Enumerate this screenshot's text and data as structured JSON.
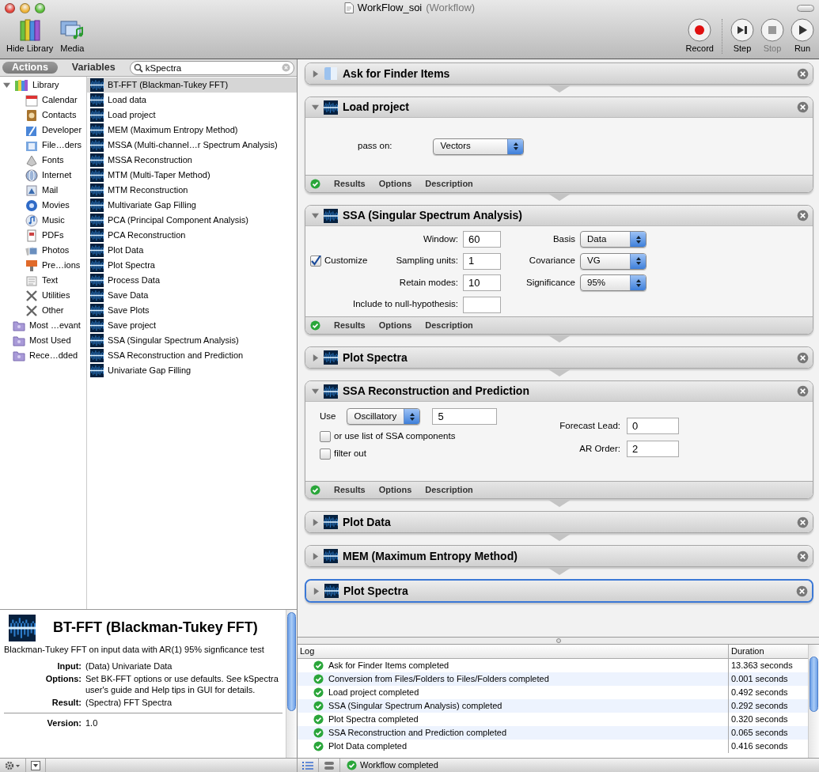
{
  "window": {
    "title": "WorkFlow_soi",
    "subtitle": "(Workflow)"
  },
  "toolbar": {
    "left": [
      {
        "label": "Hide Library",
        "kind": "library"
      },
      {
        "label": "Media",
        "kind": "media"
      }
    ],
    "right": [
      {
        "label": "Record",
        "kind": "record",
        "disabled": false
      },
      {
        "label": "Step",
        "kind": "step",
        "disabled": false
      },
      {
        "label": "Stop",
        "kind": "stop",
        "disabled": true
      },
      {
        "label": "Run",
        "kind": "run",
        "disabled": false
      }
    ]
  },
  "library_tabs": [
    {
      "label": "Actions",
      "selected": true
    },
    {
      "label": "Variables",
      "selected": false
    }
  ],
  "search": {
    "value": "kSpectra"
  },
  "categories": [
    {
      "label": "Library",
      "kind": "library",
      "children": [
        {
          "label": "Calendar",
          "kind": "calendar"
        },
        {
          "label": "Contacts",
          "kind": "contacts"
        },
        {
          "label": "Developer",
          "kind": "developer"
        },
        {
          "label": "File…ders",
          "kind": "files"
        },
        {
          "label": "Fonts",
          "kind": "fonts"
        },
        {
          "label": "Internet",
          "kind": "internet"
        },
        {
          "label": "Mail",
          "kind": "mail"
        },
        {
          "label": "Movies",
          "kind": "movies"
        },
        {
          "label": "Music",
          "kind": "music"
        },
        {
          "label": "PDFs",
          "kind": "pdfs"
        },
        {
          "label": "Photos",
          "kind": "photos"
        },
        {
          "label": "Pre…ions",
          "kind": "presentations"
        },
        {
          "label": "Text",
          "kind": "text"
        },
        {
          "label": "Utilities",
          "kind": "tools"
        },
        {
          "label": "Other",
          "kind": "tools"
        }
      ]
    },
    {
      "label": "Most …evant",
      "kind": "smart_folder"
    },
    {
      "label": "Most Used",
      "kind": "smart_folder"
    },
    {
      "label": "Rece…dded",
      "kind": "smart_folder"
    }
  ],
  "actions": [
    {
      "label": "BT-FFT (Blackman-Tukey FFT)",
      "selected": true
    },
    {
      "label": "Load data",
      "selected": false
    },
    {
      "label": "Load project",
      "selected": false
    },
    {
      "label": "MEM (Maximum Entropy Method)",
      "selected": false
    },
    {
      "label": "MSSA (Multi-channel…r Spectrum Analysis)",
      "selected": false
    },
    {
      "label": "MSSA Reconstruction",
      "selected": false
    },
    {
      "label": "MTM (Multi-Taper Method)",
      "selected": false
    },
    {
      "label": "MTM Reconstruction",
      "selected": false
    },
    {
      "label": "Multivariate Gap Filling",
      "selected": false
    },
    {
      "label": "PCA (Principal Component Analysis)",
      "selected": false
    },
    {
      "label": "PCA Reconstruction",
      "selected": false
    },
    {
      "label": "Plot Data",
      "selected": false
    },
    {
      "label": "Plot Spectra",
      "selected": false
    },
    {
      "label": "Process Data",
      "selected": false
    },
    {
      "label": "Save Data",
      "selected": false
    },
    {
      "label": "Save Plots",
      "selected": false
    },
    {
      "label": "Save project",
      "selected": false
    },
    {
      "label": "SSA (Singular Spectrum Analysis)",
      "selected": false
    },
    {
      "label": "SSA Reconstruction and Prediction",
      "selected": false
    },
    {
      "label": "Univariate Gap Filling",
      "selected": false
    }
  ],
  "description": {
    "title": "BT-FFT (Blackman-Tukey FFT)",
    "summary": "Blackman-Tukey FFT on input data with AR(1) 95% signficance test",
    "fields": [
      {
        "label": "Input:",
        "value": "(Data) Univariate Data"
      },
      {
        "label": "Options:",
        "value": "Set BK-FFT options or use defaults. See kSpectra user's guide and Help tips in GUI for details."
      },
      {
        "label": "Result:",
        "value": "(Spectra) FFT Spectra"
      }
    ],
    "version": {
      "label": "Version:",
      "value": "1.0"
    }
  },
  "workflow": [
    {
      "title": "Ask for Finder Items",
      "kind": "finder",
      "expanded": false,
      "selected": false
    },
    {
      "title": "Load project",
      "kind": "spectrum",
      "expanded": true,
      "selected": false,
      "body": {
        "kind": "pass_on",
        "label": "pass on:",
        "value": "Vectors"
      },
      "footer": [
        "Results",
        "Options",
        "Description"
      ]
    },
    {
      "title": "SSA (Singular Spectrum Analysis)",
      "kind": "spectrum",
      "expanded": true,
      "selected": false,
      "body": {
        "kind": "ssa",
        "customize": {
          "label": "Customize",
          "checked": true
        },
        "fields": [
          {
            "label": "Window:",
            "value": "60"
          },
          {
            "label": "Sampling units:",
            "value": "1"
          },
          {
            "label": "Retain modes:",
            "value": "10"
          },
          {
            "label": "Include to null-hypothesis:"
          }
        ],
        "options": [
          {
            "label": "Basis",
            "value": "Data"
          },
          {
            "label": "Covariance",
            "value": "VG"
          },
          {
            "label": "Significance",
            "value": "95%"
          }
        ]
      },
      "footer": [
        "Results",
        "Options",
        "Description"
      ]
    },
    {
      "title": "Plot Spectra",
      "kind": "spectrum",
      "expanded": false,
      "selected": false
    },
    {
      "title": "SSA Reconstruction and Prediction",
      "kind": "spectrum",
      "expanded": true,
      "selected": false,
      "body": {
        "kind": "reconstruction",
        "use_label": "Use",
        "use_value": "Oscillatory",
        "count": "5",
        "checkboxes": [
          {
            "label": "or use list of SSA components",
            "checked": false
          },
          {
            "label": "filter out",
            "checked": false
          }
        ],
        "fields": [
          {
            "label": "Forecast Lead:",
            "value": "0"
          },
          {
            "label": "AR Order:",
            "value": "2"
          }
        ]
      },
      "footer": [
        "Results",
        "Options",
        "Description"
      ]
    },
    {
      "title": "Plot Data",
      "kind": "spectrum",
      "expanded": false,
      "selected": false
    },
    {
      "title": "MEM (Maximum Entropy Method)",
      "kind": "spectrum",
      "expanded": false,
      "selected": false
    },
    {
      "title": "Plot Spectra",
      "kind": "spectrum",
      "expanded": false,
      "selected": true
    }
  ],
  "log": {
    "columns": [
      "Log",
      "Duration"
    ],
    "rows": [
      {
        "text": "Ask for Finder Items completed",
        "duration": "13.363 seconds"
      },
      {
        "text": "Conversion from Files/Folders to Files/Folders completed",
        "duration": "0.001 seconds"
      },
      {
        "text": "Load project completed",
        "duration": "0.492 seconds"
      },
      {
        "text": "SSA (Singular Spectrum Analysis)  completed",
        "duration": "0.292 seconds"
      },
      {
        "text": "Plot Spectra completed",
        "duration": "0.320 seconds"
      },
      {
        "text": "SSA Reconstruction and Prediction completed",
        "duration": "0.065 seconds"
      },
      {
        "text": "Plot Data completed",
        "duration": "0.416 seconds"
      }
    ]
  },
  "status_bar": {
    "text": "Workflow completed"
  }
}
